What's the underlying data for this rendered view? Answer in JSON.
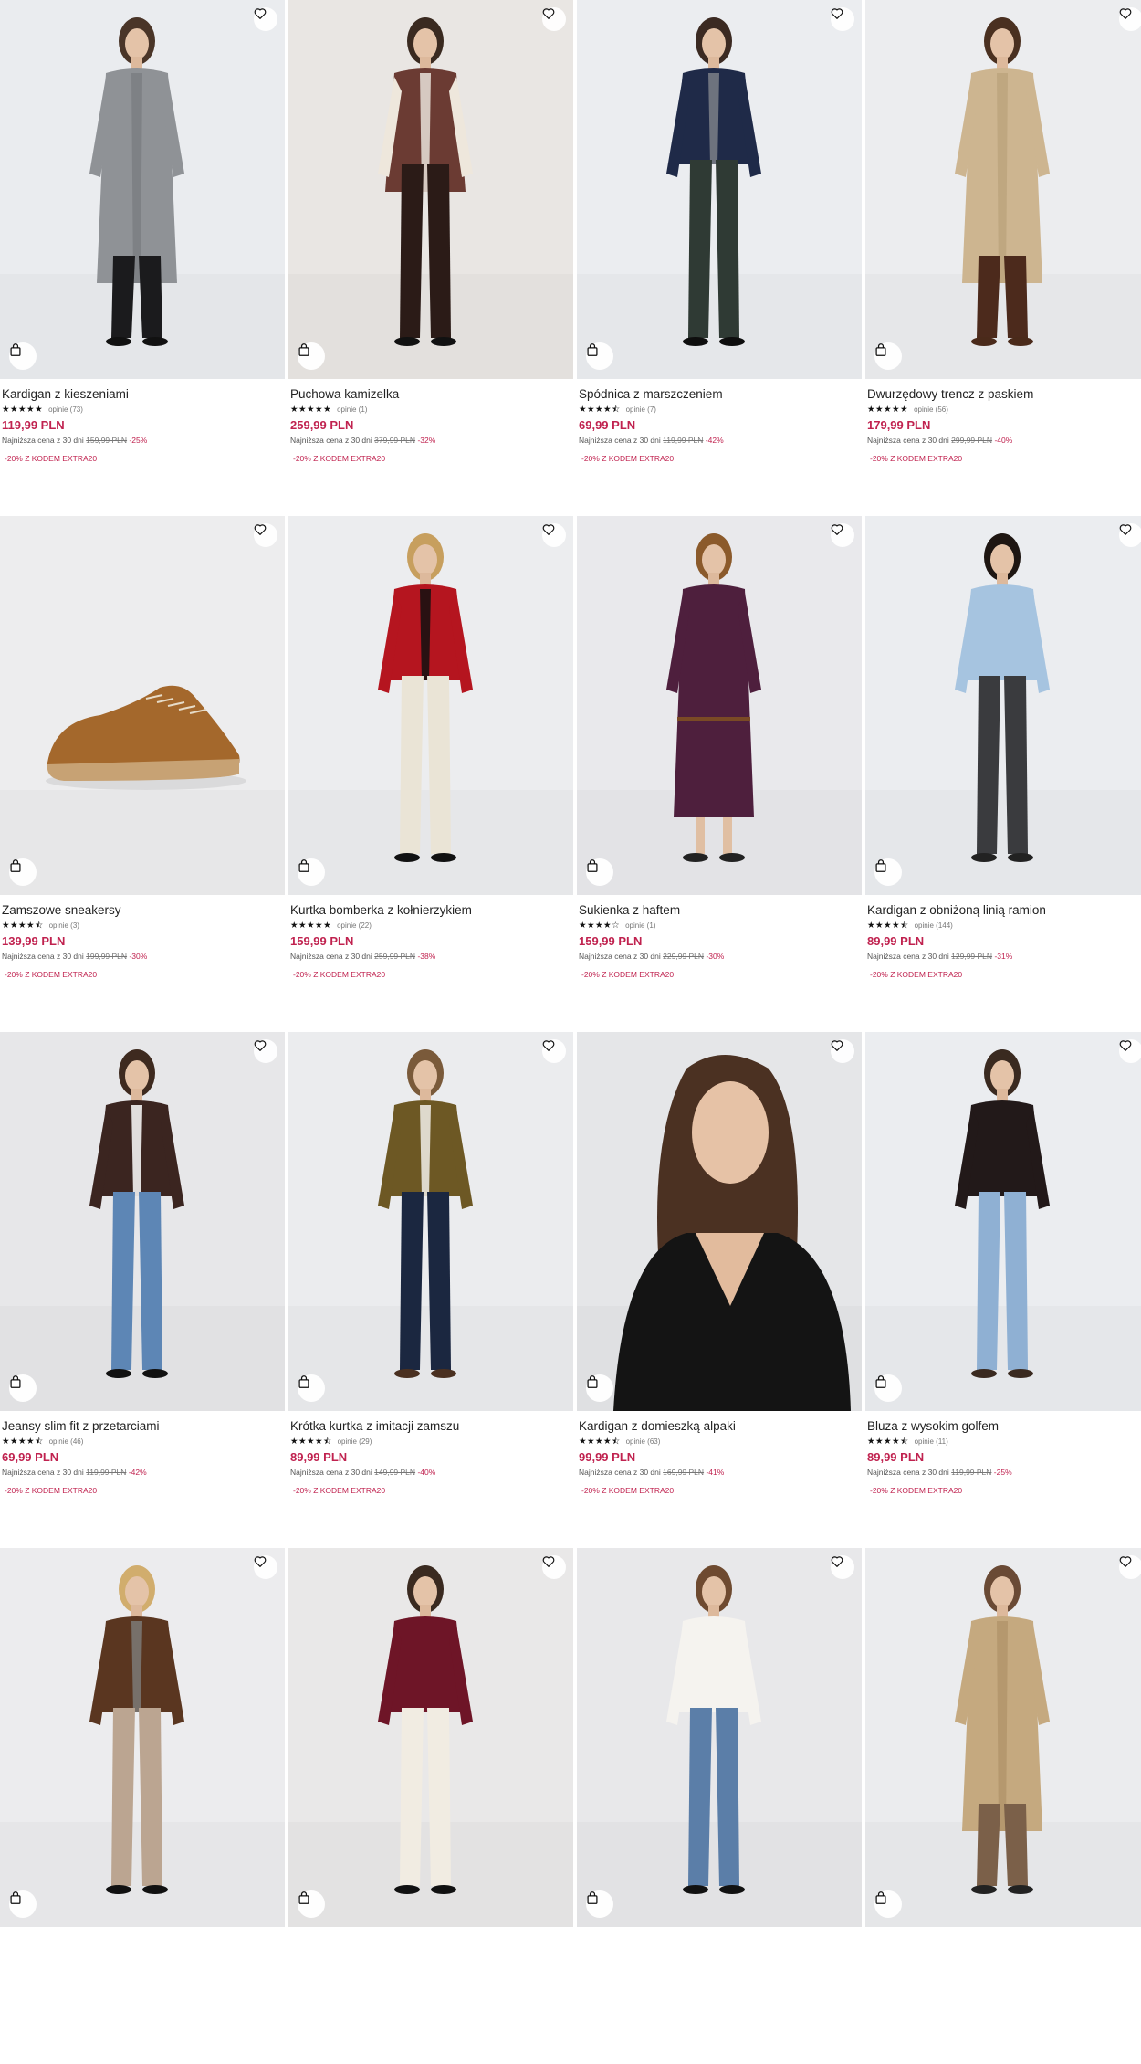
{
  "colors": {
    "price": "#c0224f",
    "promo": "#c0224f",
    "text": "#222222",
    "muted": "#777777"
  },
  "icons": {
    "favorite": "heart-icon",
    "cart": "shopping-bag-icon"
  },
  "products": [
    {
      "title": "Kardigan z kieszeniami",
      "stars": "★★★★★",
      "rating": 5,
      "reviews": "opinie (73)",
      "price": "119,99 PLN",
      "lowest_label": "Najniższa cena z 30 dni",
      "old_price": "159,99 PLN",
      "discount": "-25%",
      "promo": "-20% Z KODEM EXTRA20",
      "art": "cardigan-grey"
    },
    {
      "title": "Puchowa kamizelka",
      "stars": "★★★★★",
      "rating": 5,
      "reviews": "opinie (1)",
      "price": "259,99 PLN",
      "lowest_label": "Najniższa cena z 30 dni",
      "old_price": "379,99 PLN",
      "discount": "-32%",
      "promo": "-20% Z KODEM EXTRA20",
      "art": "puffer-vest"
    },
    {
      "title": "Spódnica z marszczeniem",
      "stars": "★★★★⯪",
      "rating": 4.5,
      "reviews": "opinie (7)",
      "price": "69,99 PLN",
      "lowest_label": "Najniższa cena z 30 dni",
      "old_price": "119,99 PLN",
      "discount": "-42%",
      "promo": "-20% Z KODEM EXTRA20",
      "art": "navy-blazer"
    },
    {
      "title": "Dwurzędowy trencz z paskiem",
      "stars": "★★★★★",
      "rating": 5,
      "reviews": "opinie (56)",
      "price": "179,99 PLN",
      "lowest_label": "Najniższa cena z 30 dni",
      "old_price": "299,99 PLN",
      "discount": "-40%",
      "promo": "-20% Z KODEM EXTRA20",
      "art": "trench-beige"
    },
    {
      "title": "Zamszowe sneakersy",
      "stars": "★★★★⯪",
      "rating": 4.5,
      "reviews": "opinie (3)",
      "price": "139,99 PLN",
      "lowest_label": "Najniższa cena z 30 dni",
      "old_price": "199,99 PLN",
      "discount": "-30%",
      "promo": "-20% Z KODEM EXTRA20",
      "art": "sneaker"
    },
    {
      "title": "Kurtka bomberka z kołnierzykiem",
      "stars": "★★★★★",
      "rating": 5,
      "reviews": "opinie (22)",
      "price": "159,99 PLN",
      "lowest_label": "Najniższa cena z 30 dni",
      "old_price": "259,99 PLN",
      "discount": "-38%",
      "promo": "-20% Z KODEM EXTRA20",
      "art": "red-bomber"
    },
    {
      "title": "Sukienka z haftem",
      "stars": "★★★★☆",
      "rating": 4,
      "reviews": "opinie (1)",
      "price": "159,99 PLN",
      "lowest_label": "Najniższa cena z 30 dni",
      "old_price": "229,99 PLN",
      "discount": "-30%",
      "promo": "-20% Z KODEM EXTRA20",
      "art": "purple-dress"
    },
    {
      "title": "Kardigan z obniżoną linią ramion",
      "stars": "★★★★⯪",
      "rating": 4.5,
      "reviews": "opinie (144)",
      "price": "89,99 PLN",
      "lowest_label": "Najniższa cena z 30 dni",
      "old_price": "129,99 PLN",
      "discount": "-31%",
      "promo": "-20% Z KODEM EXTRA20",
      "art": "blue-cardigan"
    },
    {
      "title": "Jeansy slim fit z przetarciami",
      "stars": "★★★★⯪",
      "rating": 4.5,
      "reviews": "opinie (46)",
      "price": "69,99 PLN",
      "lowest_label": "Najniższa cena z 30 dni",
      "old_price": "119,99 PLN",
      "discount": "-42%",
      "promo": "-20% Z KODEM EXTRA20",
      "art": "jeans"
    },
    {
      "title": "Krótka kurtka z imitacji zamszu",
      "stars": "★★★★⯪",
      "rating": 4.5,
      "reviews": "opinie (29)",
      "price": "89,99 PLN",
      "lowest_label": "Najniższa cena z 30 dni",
      "old_price": "149,99 PLN",
      "discount": "-40%",
      "promo": "-20% Z KODEM EXTRA20",
      "art": "olive-jacket"
    },
    {
      "title": "Kardigan z domieszką alpaki",
      "stars": "★★★★⯪",
      "rating": 4.5,
      "reviews": "opinie (63)",
      "price": "99,99 PLN",
      "lowest_label": "Najniższa cena z 30 dni",
      "old_price": "169,99 PLN",
      "discount": "-41%",
      "promo": "-20% Z KODEM EXTRA20",
      "art": "black-cardigan"
    },
    {
      "title": "Bluza z wysokim golfem",
      "stars": "★★★★⯪",
      "rating": 4.5,
      "reviews": "opinie (11)",
      "price": "89,99 PLN",
      "lowest_label": "Najniższa cena z 30 dni",
      "old_price": "119,99 PLN",
      "discount": "-25%",
      "promo": "-20% Z KODEM EXTRA20",
      "art": "black-sweatshirt"
    },
    {
      "art": "brown-jacket-trousers"
    },
    {
      "art": "burgundy-tee"
    },
    {
      "art": "white-top-jeans"
    },
    {
      "art": "camel-coat"
    }
  ]
}
